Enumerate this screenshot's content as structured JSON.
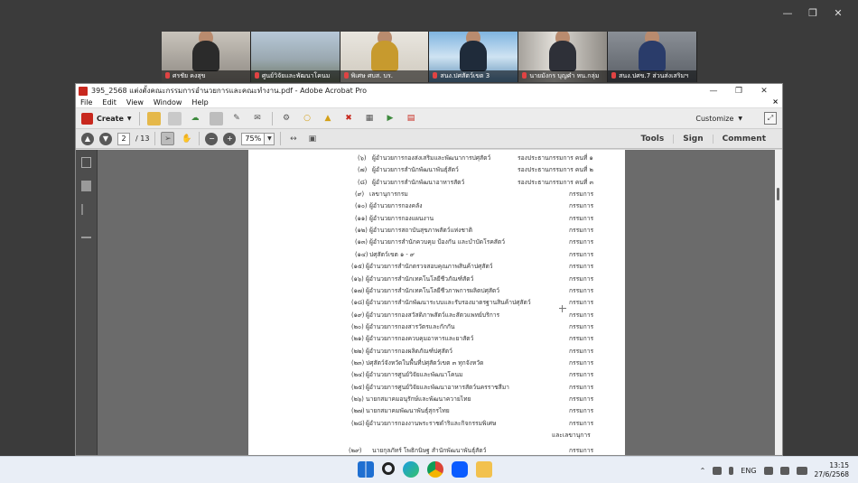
{
  "participants": [
    {
      "name": "ศรชัย คงสุข"
    },
    {
      "name": "ศูนย์วิจัยและพัฒนาโคนม"
    },
    {
      "name": "พิเศษ ศบส. บร."
    },
    {
      "name": "สนง.ปศสัตว์เขต 3"
    },
    {
      "name": "นายมังกร บุญคำ หน.กลุ่ม"
    },
    {
      "name": "สนง.ปศข.7 ส่วนส่งเสริมฯ"
    }
  ],
  "acrobat": {
    "title": "395_2568 แต่งตั้งคณะกรรมการอำนวยการและคณะทำงาน.pdf - Adobe Acrobat Pro",
    "menu": [
      "File",
      "Edit",
      "View",
      "Window",
      "Help"
    ],
    "menu_close": "×",
    "create_label": "Create",
    "customize_label": "Customize",
    "page_current": "2",
    "page_total": "/ 13",
    "zoom": "75%",
    "right_links": [
      "Tools",
      "Sign",
      "Comment"
    ]
  },
  "document_lines": [
    {
      "num": "(๖)",
      "text": "ผู้อำนวยการกองส่งเสริมและพัฒนาการปศุสัตว์",
      "role": "รองประธานกรรมการ คนที่ ๑",
      "wide": true
    },
    {
      "num": "(๗)",
      "text": "ผู้อำนวยการสำนักพัฒนาพันธุ์สัตว์",
      "role": "รองประธานกรรมการ คนที่ ๒",
      "wide": true
    },
    {
      "num": "(๘)",
      "text": "ผู้อำนวยการสำนักพัฒนาอาหารสัตว์",
      "role": "รองประธานกรรมการ คนที่ ๓",
      "wide": true
    },
    {
      "num": "(๙)",
      "text": "เลขานุการกรม",
      "role": "กรรมการ"
    },
    {
      "num": "(๑๐)",
      "text": "ผู้อำนวยการกองคลัง",
      "role": "กรรมการ"
    },
    {
      "num": "(๑๑)",
      "text": "ผู้อำนวยการกองแผนงาน",
      "role": "กรรมการ"
    },
    {
      "num": "(๑๒)",
      "text": "ผู้อำนวยการสถาบันสุขภาพสัตว์แห่งชาติ",
      "role": "กรรมการ"
    },
    {
      "num": "(๑๓)",
      "text": "ผู้อำนวยการสำนักควบคุม ป้องกัน และบำบัดโรคสัตว์",
      "role": "กรรมการ"
    },
    {
      "num": "(๑๔)",
      "text": "ปศุสัตว์เขต ๑ - ๙",
      "role": "กรรมการ"
    },
    {
      "num": "(๑๕)",
      "text": "ผู้อำนวยการสำนักตรวจสอบคุณภาพสินค้าปศุสัตว์",
      "role": "กรรมการ"
    },
    {
      "num": "(๑๖)",
      "text": "ผู้อำนวยการสำนักเทคโนโลยีชีวภัณฑ์สัตว์",
      "role": "กรรมการ"
    },
    {
      "num": "(๑๗)",
      "text": "ผู้อำนวยการสำนักเทคโนโลยีชีวภาพการผลิตปศุสัตว์",
      "role": "กรรมการ"
    },
    {
      "num": "(๑๘)",
      "text": "ผู้อำนวยการสำนักพัฒนาระบบและรับรองมาตรฐานสินค้าปศุสัตว์",
      "role": "กรรมการ"
    },
    {
      "num": "(๑๙)",
      "text": "ผู้อำนวยการกองสวัสดิภาพสัตว์และสัตวแพทย์บริการ",
      "role": "กรรมการ"
    },
    {
      "num": "(๒๐)",
      "text": "ผู้อำนวยการกองสารวัตรและกักกัน",
      "role": "กรรมการ"
    },
    {
      "num": "(๒๑)",
      "text": "ผู้อำนวยการกองควบคุมอาหารและยาสัตว์",
      "role": "กรรมการ"
    },
    {
      "num": "(๒๒)",
      "text": "ผู้อำนวยการกองผลิตภัณฑ์ปศุสัตว์",
      "role": "กรรมการ"
    },
    {
      "num": "(๒๓)",
      "text": "ปศุสัตว์จังหวัดในพื้นที่ปศุสัตว์เขต ๓ ทุกจังหวัด",
      "role": "กรรมการ"
    },
    {
      "num": "(๒๔)",
      "text": "ผู้อำนวยการศูนย์วิจัยและพัฒนาโคนม",
      "role": "กรรมการ"
    },
    {
      "num": "(๒๕)",
      "text": "ผู้อำนวยการศูนย์วิจัยและพัฒนาอาหารสัตว์นครราชสีมา",
      "role": "กรรมการ"
    },
    {
      "num": "(๒๖)",
      "text": "นายกสมาคมอนุรักษ์และพัฒนาควายไทย",
      "role": "กรรมการ"
    },
    {
      "num": "(๒๗)",
      "text": "นายกสมาคมพัฒนาพันธุ์สุกรไทย",
      "role": "กรรมการ"
    },
    {
      "num": "(๒๘)",
      "text": "ผู้อำนวยการกองงานพระราชดำริและกิจกรรมพิเศษ",
      "role": "กรรมการ"
    },
    {
      "num": "",
      "text": "",
      "role": "และเลขานุการ"
    },
    {
      "num": "(๒๙)",
      "text": "นายกุลภัทร์ โพธิกนิษฐ     สำนักพัฒนาพันธุ์สัตว์",
      "role": "กรรมการ"
    }
  ],
  "taskbar": {
    "language": "ENG",
    "time": "13:15",
    "date": "27/6/2568"
  }
}
